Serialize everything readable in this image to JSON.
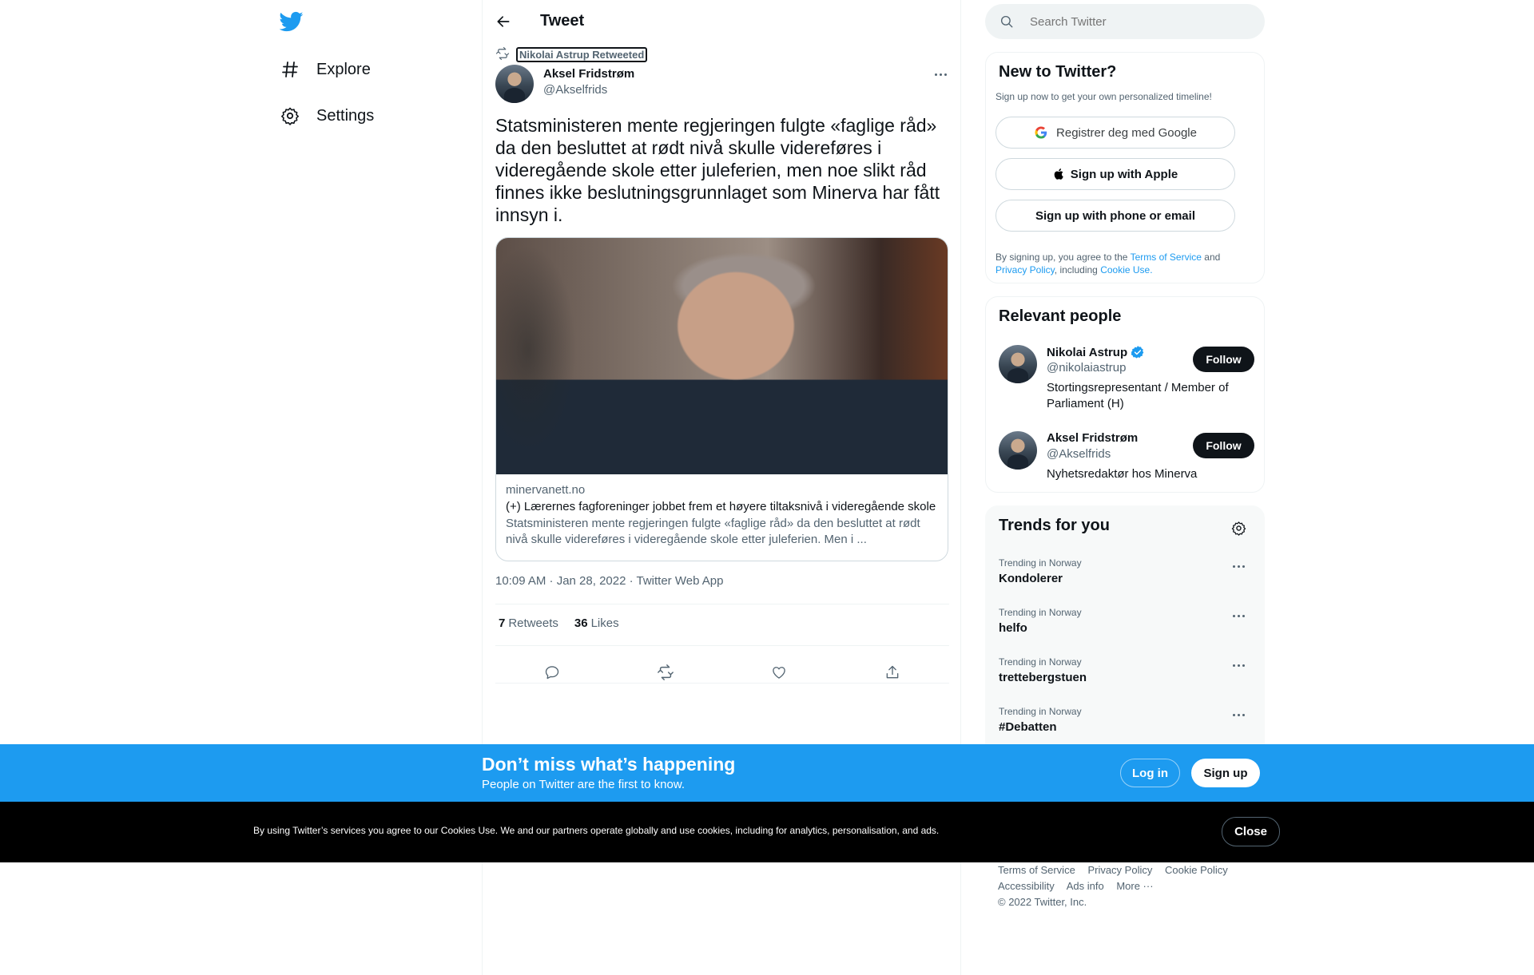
{
  "nav": {
    "logo_icon": "twitter-bird-icon",
    "items": [
      {
        "label": "Explore",
        "icon": "hashtag-icon"
      },
      {
        "label": "Settings",
        "icon": "gear-icon"
      }
    ]
  },
  "header": {
    "title": "Tweet"
  },
  "tweet": {
    "retweeted_by": "Nikolai Astrup Retweeted",
    "author_name": "Aksel Fridstrøm",
    "author_handle": "@Akselfrids",
    "text": "Statsministeren mente regjeringen fulgte «faglige råd» da den besluttet at rødt nivå skulle videreføres i videregående skole etter juleferien, men noe slikt råd finnes ikke beslutningsgrunnlaget som Minerva har fått innsyn i.",
    "card": {
      "domain": "minervanett.no",
      "title": "(+) Lærernes fagforeninger jobbet frem et høyere tiltaksnivå i videregående skole",
      "description": "Statsministeren mente regjeringen fulgte «faglige råd» da den besluttet at rødt nivå skulle videreføres i videregående skole etter juleferien. Men i ..."
    },
    "meta": "10:09 AM · Jan 28, 2022 · Twitter Web App",
    "retweets_count": "7",
    "retweets_label": "Retweets",
    "likes_count": "36",
    "likes_label": "Likes"
  },
  "search": {
    "placeholder": "Search Twitter"
  },
  "new_to_twitter": {
    "title": "New to Twitter?",
    "subtitle": "Sign up now to get your own personalized timeline!",
    "google_label": "Registrer deg med Google",
    "apple_label": "Sign up with Apple",
    "phone_label": "Sign up with phone or email",
    "legal_prefix": "By signing up, you agree to the",
    "terms": "Terms of Service",
    "and": "and",
    "privacy": "Privacy Policy",
    "including": ", including",
    "cookie": "Cookie Use."
  },
  "relevant_people": {
    "title": "Relevant people",
    "people": [
      {
        "name": "Nikolai Astrup",
        "handle": "@nikolaiastrup",
        "bio": "Stortingsrepresentant / Member of Parliament (H)",
        "verified": true,
        "follow": "Follow"
      },
      {
        "name": "Aksel Fridstrøm",
        "handle": "@Akselfrids",
        "bio": "Nyhetsredaktør hos Minerva",
        "verified": false,
        "follow": "Follow"
      }
    ]
  },
  "trends": {
    "title": "Trends for you",
    "items": [
      {
        "context": "Trending in Norway",
        "name": "Kondolerer"
      },
      {
        "context": "Trending in Norway",
        "name": "helfo"
      },
      {
        "context": "Trending in Norway",
        "name": "trettebergstuen"
      },
      {
        "context": "Trending in Norway",
        "name": "#Debatten"
      }
    ]
  },
  "footer": {
    "links_row1": [
      "Terms of Service",
      "Privacy Policy",
      "Cookie Policy"
    ],
    "links_row2": [
      "Accessibility",
      "Ads info",
      "More ···"
    ],
    "copyright": "© 2022 Twitter, Inc."
  },
  "login_bar": {
    "title": "Don’t miss what’s happening",
    "subtitle": "People on Twitter are the first to know.",
    "login": "Log in",
    "signup": "Sign up"
  },
  "cookie_bar": {
    "text": "By using Twitter’s services you agree to our Cookies Use. We and our partners operate globally and use cookies, including for analytics, personalisation, and ads.",
    "close": "Close"
  },
  "colors": {
    "accent": "#1d9bf0",
    "text": "#0f1419",
    "muted": "#536471",
    "border": "#eff3f4"
  }
}
